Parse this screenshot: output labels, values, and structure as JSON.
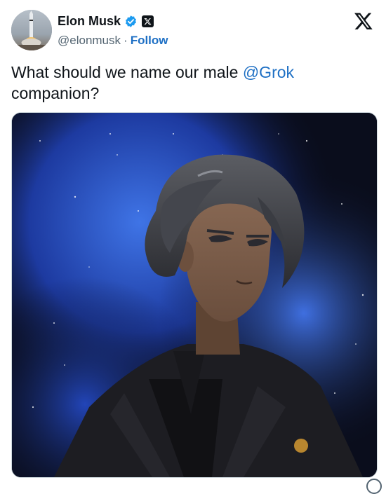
{
  "tweet": {
    "author": {
      "display_name": "Elon Musk",
      "handle": "@elonmusk",
      "separator": "·",
      "follow_label": "Follow",
      "avatar_icon": "rocket-launch-avatar",
      "verified_icon": "verified-badge-icon",
      "affiliation_icon": "x-affiliation-badge-icon"
    },
    "text_prefix": "What should we name our male ",
    "mention": "@Grok",
    "text_suffix": "companion?",
    "media": {
      "icon": "anime-male-companion-illustration"
    },
    "platform_icon": "x-logo-icon"
  },
  "colors": {
    "link": "#1d6fc4",
    "verified": "#1d9bf0",
    "text": "#0f1419",
    "secondary": "#536471"
  }
}
